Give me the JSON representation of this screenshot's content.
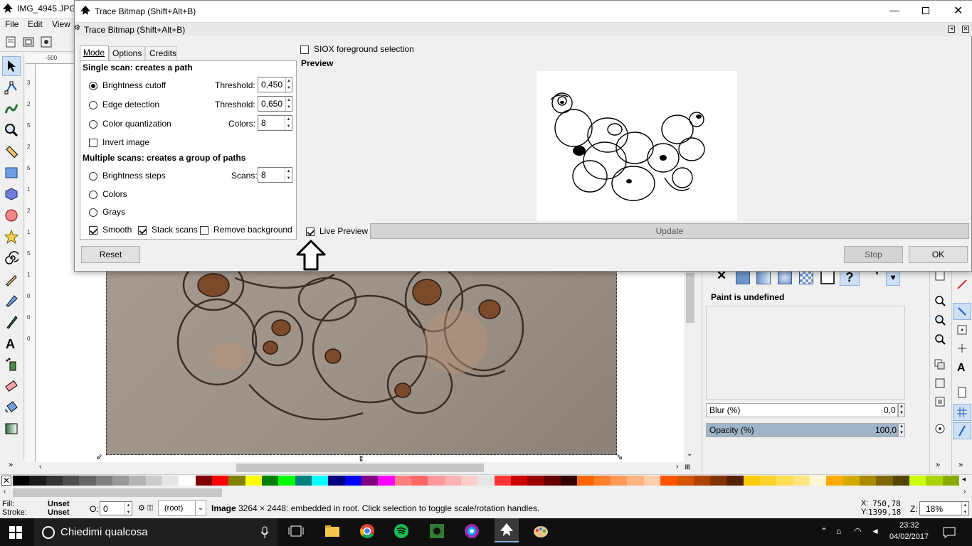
{
  "main_window": {
    "title": "IMG_4945.JPG -",
    "menu": [
      "File",
      "Edit",
      "View"
    ]
  },
  "dialog": {
    "title": "Trace Bitmap (Shift+Alt+B)",
    "inner_title": "Trace Bitmap (Shift+Alt+B)",
    "tabs": [
      "Mode",
      "Options",
      "Credits"
    ],
    "single_scan_header": "Single scan: creates a path",
    "brightness_cutoff": "Brightness cutoff",
    "edge_detection": "Edge detection",
    "color_quantization": "Color quantization",
    "invert_image": "Invert image",
    "threshold_label": "Threshold:",
    "threshold_1": "0,450",
    "threshold_2": "0,650",
    "colors_label": "Colors:",
    "colors_value": "8",
    "multi_scan_header": "Multiple scans: creates a group of paths",
    "brightness_steps": "Brightness steps",
    "scans_label": "Scans:",
    "scans_value": "8",
    "colors_option": "Colors",
    "grays_option": "Grays",
    "smooth": "Smooth",
    "stack_scans": "Stack scans",
    "remove_background": "Remove background",
    "siox": "SIOX foreground selection",
    "preview_label": "Preview",
    "live_preview": "Live Preview",
    "update": "Update",
    "reset": "Reset",
    "stop": "Stop",
    "ok": "OK"
  },
  "fill_panel": {
    "paint_undefined": "Paint is undefined",
    "blur_label": "Blur (%)",
    "blur_value": "0,0",
    "opacity_label": "Opacity (%)",
    "opacity_value": "100,0",
    "opacity_level": 1.0
  },
  "statusbar": {
    "fill_label": "Fill:",
    "fill_value": "Unset",
    "stroke_label": "Stroke:",
    "stroke_value": "Unset",
    "o_label": "O:",
    "o_value": "0",
    "layer": "(root)",
    "message_bold": "Image",
    "message": "3264 × 2448: embedded in root. Click selection to toggle scale/rotation handles.",
    "x_label": "X:",
    "x_value": "750,78",
    "y_label": "Y:",
    "y_value": "1399,18",
    "z_label": "Z:",
    "zoom": "18%"
  },
  "ruler": {
    "top_mark": "-500",
    "left_marks": [
      "3",
      "2",
      "5",
      "2",
      "5",
      "1",
      "2",
      "1",
      "5",
      "1",
      "0",
      "0",
      "0"
    ]
  },
  "taskbar": {
    "search_placeholder": "Chiedimi qualcosa",
    "time": "23:32",
    "date": "04/02/2017"
  },
  "palette_colors": [
    "#000000",
    "#1a1a1a",
    "#333333",
    "#4d4d4d",
    "#666666",
    "#808080",
    "#999999",
    "#b3b3b3",
    "#cccccc",
    "#e6e6e6",
    "#ffffff",
    "#800000",
    "#ff0000",
    "#808000",
    "#ffff00",
    "#008000",
    "#00ff00",
    "#008080",
    "#00ffff",
    "#000080",
    "#0000ff",
    "#800080",
    "#ff00ff",
    "#ff8080",
    "#ff6666",
    "#ff9999",
    "#ffb3b3",
    "#ffcccc",
    "#e6e6e6",
    "#ff3333",
    "#cc0000",
    "#990000",
    "#660000",
    "#330000",
    "#ff6600",
    "#ff7f2a",
    "#ff9955",
    "#ffb380",
    "#ffccaa",
    "#ff5500",
    "#d45500",
    "#aa4400",
    "#803300",
    "#552200",
    "#ffcc00",
    "#ffd42a",
    "#ffdd55",
    "#ffe680",
    "#fff6d5",
    "#ffaa00",
    "#d4aa00",
    "#aa8800",
    "#806600",
    "#554400",
    "#ccff00",
    "#aad400",
    "#88aa00"
  ]
}
